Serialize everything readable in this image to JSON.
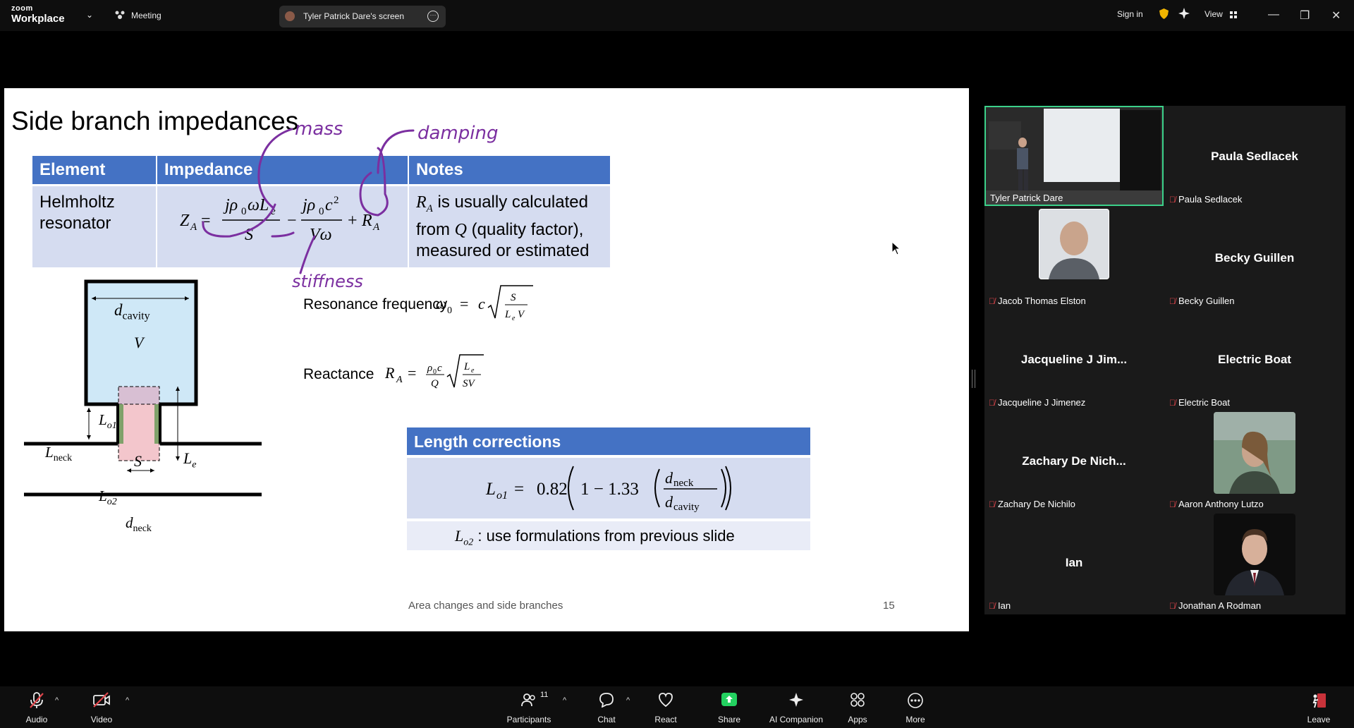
{
  "topbar": {
    "logo_small": "zoom",
    "logo_big": "Workplace",
    "meeting_label": "Meeting",
    "screen_label": "Tyler Patrick Dare's screen",
    "sign_in": "Sign in",
    "view_label": "View"
  },
  "slide": {
    "title": "Side branch impedances",
    "table": {
      "headers": [
        "Element",
        "Impedance",
        "Notes"
      ],
      "row": {
        "element": "Helmholtz resonator",
        "note_lines": [
          "R",
          "A",
          " is usually calculated",
          "from ",
          "Q",
          " (quality factor),",
          "measured or estimated"
        ]
      }
    },
    "diagram": {
      "d_cavity": "d",
      "d_cavity_sub": "cavity",
      "volume": "V",
      "l_o1": "L",
      "l_o1_sub": "o1",
      "l_neck": "L",
      "l_neck_sub": "neck",
      "s_label": "S",
      "l_e": "L",
      "l_e_sub": "e",
      "l_o2": "L",
      "l_o2_sub": "o2",
      "d_neck": "d",
      "d_neck_sub": "neck"
    },
    "resonance_label": "Resonance frequency",
    "reactance_label": "Reactance",
    "length_corrections": {
      "title": "Length corrections",
      "coef1": "0.82",
      "coef2": "1 − 1.33",
      "row2_text": " : use formulations from previous slide"
    },
    "annotations": {
      "mass": "mass",
      "damping": "damping",
      "stiffness": "stiffness"
    },
    "footer_text": "Area changes and side branches",
    "page_number": "15"
  },
  "gallery": {
    "tiles": [
      {
        "label": "Tyler Patrick Dare",
        "name": "",
        "kind": "video"
      },
      {
        "label": "Paula Sedlacek",
        "name": "Paula Sedlacek",
        "kind": "name"
      },
      {
        "label": "Jacob Thomas Elston",
        "name": "",
        "kind": "photo"
      },
      {
        "label": "Becky Guillen",
        "name": "Becky Guillen",
        "kind": "name"
      },
      {
        "label": "Jacqueline J Jimenez",
        "name": "Jacqueline J Jim...",
        "kind": "name"
      },
      {
        "label": "Electric Boat",
        "name": "Electric Boat",
        "kind": "name"
      },
      {
        "label": "Zachary De Nichilo",
        "name": "Zachary De Nich...",
        "kind": "name"
      },
      {
        "label": "Aaron Anthony Lutzo",
        "name": "",
        "kind": "photo"
      },
      {
        "label": "Ian",
        "name": "Ian",
        "kind": "name"
      },
      {
        "label": "Jonathan A Rodman",
        "name": "",
        "kind": "photo"
      }
    ],
    "active_speaker_color": "#3cd18a"
  },
  "bottombar": {
    "audio": "Audio",
    "video": "Video",
    "participants": "Participants",
    "participants_count": "11",
    "chat": "Chat",
    "react": "React",
    "share": "Share",
    "ai_companion": "AI Companion",
    "apps": "Apps",
    "more": "More",
    "leave": "Leave"
  },
  "colors": {
    "table_header": "#4472c4",
    "table_body": "#d5dcf0",
    "ink_purple": "#7b2fa0",
    "share_green": "#23d160",
    "mute_red": "#e0454b"
  }
}
